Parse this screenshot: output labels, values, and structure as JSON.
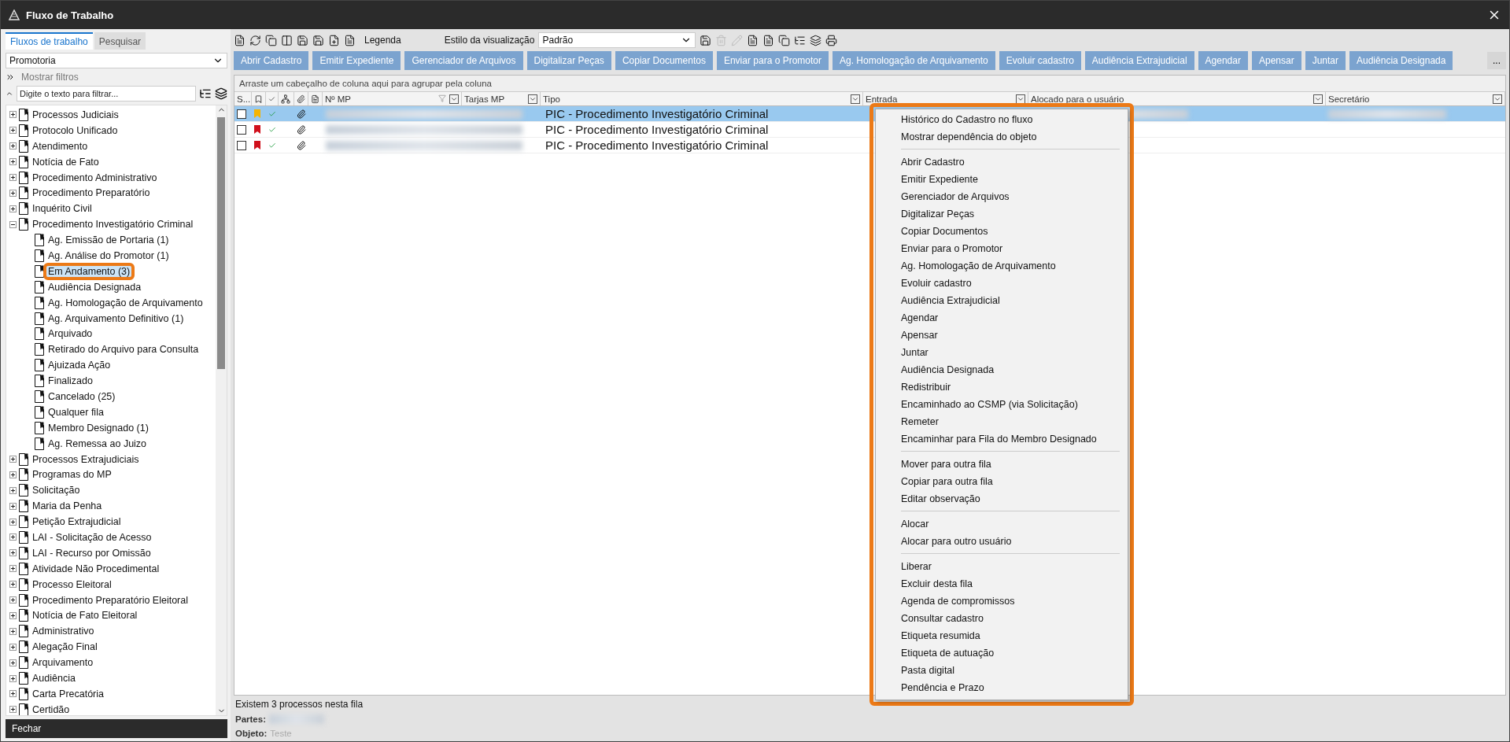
{
  "window": {
    "title": "Fluxo de Trabalho"
  },
  "sidebar": {
    "tabs": [
      {
        "label": "Fluxos de trabalho",
        "selected": true
      },
      {
        "label": "Pesquisar",
        "selected": false
      }
    ],
    "dropdown": {
      "value": "Promotoria"
    },
    "filters_link": "Mostrar filtros",
    "filter": {
      "placeholder": "Digite o texto para filtrar..."
    },
    "tree": [
      {
        "label": "Processos Judiciais",
        "expanded": false,
        "selected": false
      },
      {
        "label": "Protocolo Unificado",
        "expanded": false,
        "selected": false
      },
      {
        "label": "Atendimento",
        "expanded": false,
        "selected": false
      },
      {
        "label": "Notícia de Fato",
        "expanded": false,
        "selected": false
      },
      {
        "label": "Procedimento Administrativo",
        "expanded": false,
        "selected": false
      },
      {
        "label": "Procedimento Preparatório",
        "expanded": false,
        "selected": false
      },
      {
        "label": "Inquérito Civil",
        "expanded": false,
        "selected": false
      },
      {
        "label": "Procedimento Investigatório Criminal",
        "expanded": true,
        "selected": false,
        "children": [
          {
            "label": "Ag. Emissão de Portaria (1)",
            "selected": false
          },
          {
            "label": "Ag. Análise do Promotor (1)",
            "selected": false
          },
          {
            "label": "Em Andamento (3)",
            "selected": true,
            "highlighted": true
          },
          {
            "label": "Audiência Designada",
            "selected": false
          },
          {
            "label": "Ag. Homologação de Arquivamento",
            "selected": false
          },
          {
            "label": "Ag. Arquivamento Definitivo (1)",
            "selected": false
          },
          {
            "label": "Arquivado",
            "selected": false
          },
          {
            "label": "Retirado do Arquivo para Consulta",
            "selected": false
          },
          {
            "label": "Ajuizada Ação",
            "selected": false
          },
          {
            "label": "Finalizado",
            "selected": false
          },
          {
            "label": "Cancelado (25)",
            "selected": false
          },
          {
            "label": "Qualquer fila",
            "selected": false
          },
          {
            "label": "Membro Designado (1)",
            "selected": false
          },
          {
            "label": "Ag. Remessa ao Juizo",
            "selected": false
          }
        ]
      },
      {
        "label": "Processos Extrajudiciais",
        "expanded": false,
        "selected": false
      },
      {
        "label": "Programas do MP",
        "expanded": false,
        "selected": false
      },
      {
        "label": "Solicitação",
        "expanded": false,
        "selected": false
      },
      {
        "label": "Maria da Penha",
        "expanded": false,
        "selected": false
      },
      {
        "label": "Petição Extrajudicial",
        "expanded": false,
        "selected": false
      },
      {
        "label": "LAI - Solicitação de Acesso",
        "expanded": false,
        "selected": false
      },
      {
        "label": "LAI - Recurso por Omissão",
        "expanded": false,
        "selected": false
      },
      {
        "label": "Atividade Não Procedimental",
        "expanded": false,
        "selected": false
      },
      {
        "label": "Processo Eleitoral",
        "expanded": false,
        "selected": false
      },
      {
        "label": "Procedimento Preparatório Eleitoral",
        "expanded": false,
        "selected": false
      },
      {
        "label": "Notícia de Fato Eleitoral",
        "expanded": false,
        "selected": false
      },
      {
        "label": "Administrativo",
        "expanded": false,
        "selected": false
      },
      {
        "label": "Alegação Final",
        "expanded": false,
        "selected": false
      },
      {
        "label": "Arquivamento",
        "expanded": false,
        "selected": false
      },
      {
        "label": "Audiência",
        "expanded": false,
        "selected": false
      },
      {
        "label": "Carta Precatória",
        "expanded": false,
        "selected": false
      },
      {
        "label": "Certidão",
        "expanded": false,
        "selected": false
      }
    ],
    "close_button": "Fechar"
  },
  "toolbar": {
    "legend": "Legenda",
    "view_style_label": "Estilo da visualização",
    "view_style": "Padrão"
  },
  "actions": [
    "Abrir Cadastro",
    "Emitir Expediente",
    "Gerenciador de Arquivos",
    "Digitalizar Peças",
    "Copiar Documentos",
    "Enviar para o Promotor",
    "Ag. Homologação de Arquivamento",
    "Evoluir cadastro",
    "Audiência Extrajudicial",
    "Agendar",
    "Apensar",
    "Juntar",
    "Audiência Designada"
  ],
  "more_button": "...",
  "table": {
    "group_hint": "Arraste um cabeçalho de coluna aqui para agrupar pela coluna",
    "columns": [
      "S...",
      "Nº MP",
      "Tarjas MP",
      "Tipo",
      "Entrada",
      "Alocado para o usuário",
      "Secretário"
    ],
    "rows": [
      {
        "selected": true,
        "checked": false,
        "color": "#f5b400",
        "tipo": "PIC - Procedimento Investigatório Criminal"
      },
      {
        "selected": false,
        "checked": false,
        "color": "#d0101c",
        "tipo": "PIC - Procedimento Investigatório Criminal"
      },
      {
        "selected": false,
        "checked": false,
        "color": "#d0101c",
        "tipo": "PIC - Procedimento Investigatório Criminal"
      }
    ]
  },
  "status": {
    "count": "Existem 3 processos nesta fila",
    "parties_label": "Partes:",
    "object_label": "Objeto:",
    "object_value": "Teste"
  },
  "context_menu": {
    "highlighted": true,
    "groups": [
      [
        "Histórico do Cadastro no fluxo",
        "Mostrar dependência do objeto"
      ],
      [
        "Abrir Cadastro",
        "Emitir Expediente",
        "Gerenciador de Arquivos",
        "Digitalizar Peças",
        "Copiar Documentos",
        "Enviar para o Promotor",
        "Ag. Homologação de Arquivamento",
        "Evoluir cadastro",
        "Audiência Extrajudicial",
        "Agendar",
        "Apensar",
        "Juntar",
        "Audiência Designada",
        "Redistribuir",
        "Encaminhado ao CSMP (via Solicitação)",
        "Remeter",
        "Encaminhar para Fila do Membro Designado"
      ],
      [
        "Mover para outra fila",
        "Copiar para outra fila",
        "Editar observação"
      ],
      [
        "Alocar",
        "Alocar para outro usuário"
      ],
      [
        "Liberar",
        "Excluir desta fila",
        "Agenda de compromissos",
        "Consultar cadastro",
        "Etiqueta resumida",
        "Etiqueta de autuação",
        "Pasta digital",
        "Pendência e Prazo"
      ]
    ]
  }
}
